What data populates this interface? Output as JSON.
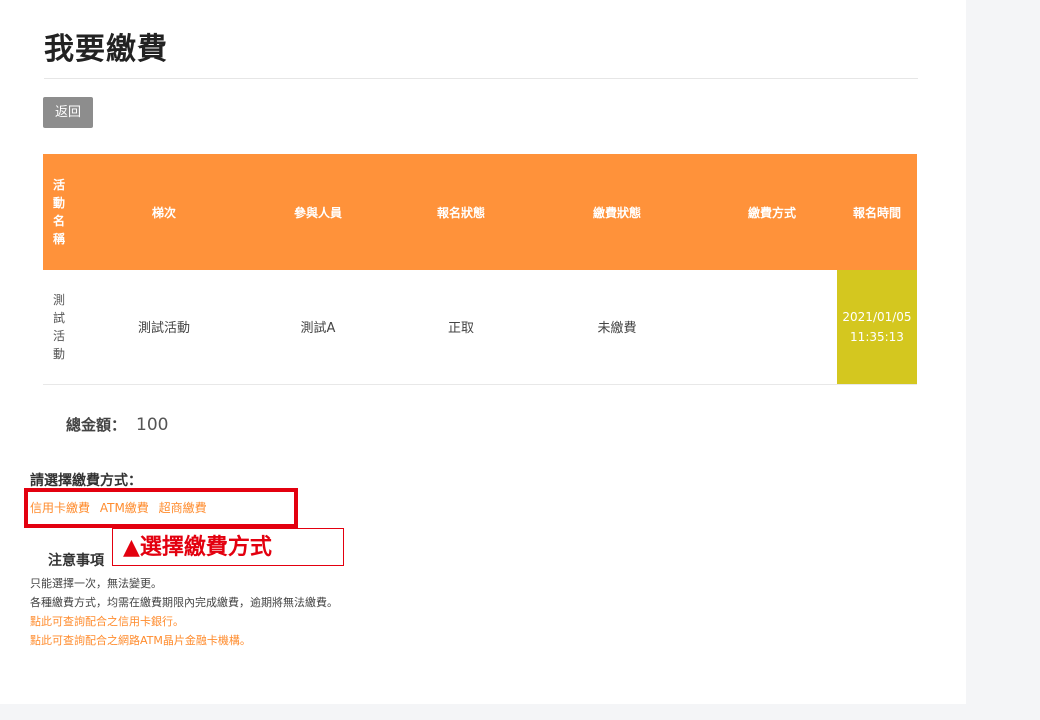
{
  "page": {
    "title": "我要繳費"
  },
  "back_button": {
    "label": "返回"
  },
  "table": {
    "headers": [
      "活動名稱",
      "梯次",
      "參與人員",
      "報名狀態",
      "繳費狀態",
      "繳費方式",
      "報名時間"
    ],
    "row": {
      "name": "測試活動",
      "session": "測試活動",
      "participant": "測試A",
      "reg_status": "正取",
      "pay_status": "未繳費",
      "pay_method": "",
      "reg_date": "2021/01/05",
      "reg_time": "11:35:13"
    },
    "colors": {
      "header_bg": "#ff923a",
      "time_bg": "#d4c71f"
    }
  },
  "total": {
    "label": "總金額：",
    "value": "100"
  },
  "payment": {
    "title": "請選擇繳費方式：",
    "methods": [
      "信用卡繳費",
      "ATM繳費",
      "超商繳費"
    ],
    "accent": "#ff8c2e"
  },
  "annotation": {
    "callout": "▲選擇繳費方式",
    "color": "#e3000f"
  },
  "notes": {
    "title": "注意事項",
    "lines": [
      "只能選擇一次，無法變更。",
      "各種繳費方式，均需在繳費期限內完成繳費，逾期將無法繳費。"
    ],
    "links": [
      "點此可查詢配合之信用卡銀行。",
      "點此可查詢配合之網路ATM晶片金融卡機構。"
    ]
  }
}
